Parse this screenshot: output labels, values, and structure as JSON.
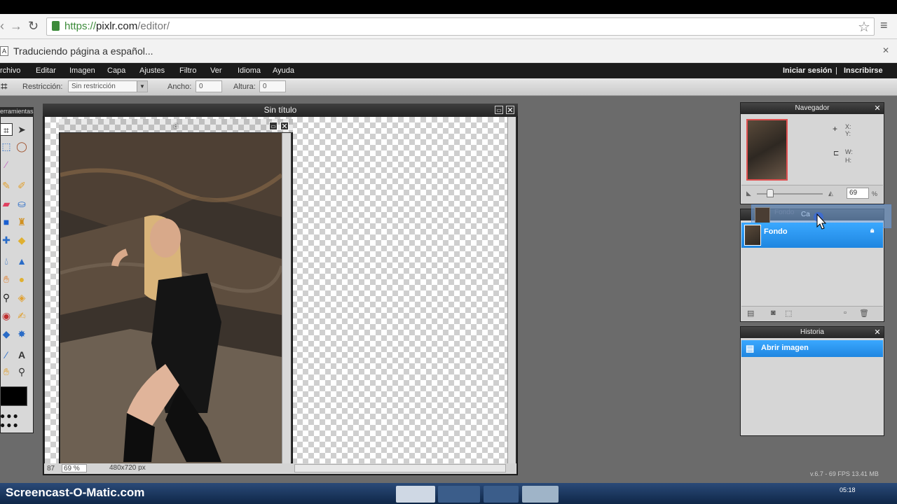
{
  "browser": {
    "url_secure": "https://",
    "url_host": "pixlr.com",
    "url_path": "/editor/",
    "translate_text": "Traduciendo página a español..."
  },
  "menu": {
    "items": [
      "rchivo",
      "Editar",
      "Imagen",
      "Capa",
      "Ajustes",
      "Filtro",
      "Ver",
      "Idioma",
      "Ayuda"
    ],
    "login": "Iniciar sesión",
    "separator": "|",
    "register": "Inscribirse"
  },
  "options": {
    "restriction_label": "Restricción:",
    "restriction_value": "Sin restricción",
    "width_label": "Ancho:",
    "width_value": "0",
    "height_label": "Altura:",
    "height_value": "0"
  },
  "tools": {
    "title": "erramientas"
  },
  "doc": {
    "title": "Sin título",
    "status_zoom": "87"
  },
  "image": {
    "title": "a",
    "zoom": "69",
    "zoom_unit": "%",
    "size": "480x720 px"
  },
  "navigator": {
    "title": "Navegador",
    "x_label": "X:",
    "y_label": "Y:",
    "w_label": "W:",
    "h_label": "H:",
    "zoom": "69",
    "zoom_unit": "%"
  },
  "layers": {
    "title": "Ca",
    "drag_ghost": "Fondo",
    "items": [
      {
        "name": "Fondo",
        "selected": true
      }
    ]
  },
  "history": {
    "title": "Historia",
    "items": [
      "Abrir imagen"
    ]
  },
  "footer": {
    "fps": "v.6.7 - 69 FPS 13.41 MB",
    "watermark": "Screencast-O-Matic.com",
    "clock": "05:18"
  },
  "colors": {
    "accent": "#1f86e0",
    "menubar": "#1b1b1b",
    "workspace": "#6b6b6b"
  }
}
